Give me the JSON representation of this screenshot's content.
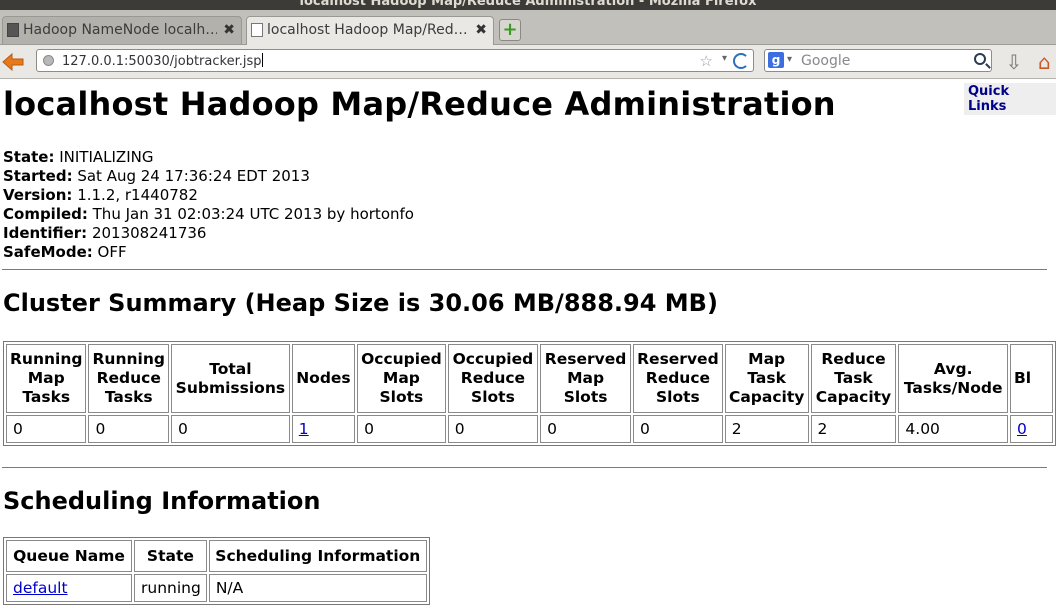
{
  "window": {
    "title": "localhost Hadoop Map/Reduce Administration - Mozilla Firefox"
  },
  "tabs": [
    {
      "label": "Hadoop NameNode localh…",
      "close": "✖"
    },
    {
      "label": "localhost Hadoop Map/Red…",
      "close": "✖"
    }
  ],
  "navbar": {
    "url": "127.0.0.1:50030/jobtracker.jsp",
    "search_placeholder": "Google",
    "search_engine_letter": "g",
    "star": "☆",
    "dropdown": "▾"
  },
  "page": {
    "quick_links": "Quick Links",
    "title": "localhost Hadoop Map/Reduce Administration",
    "info": [
      {
        "label": "State:",
        "value": " INITIALIZING"
      },
      {
        "label": "Started:",
        "value": " Sat Aug 24 17:36:24 EDT 2013"
      },
      {
        "label": "Version:",
        "value": " 1.1.2, r1440782"
      },
      {
        "label": "Compiled:",
        "value": " Thu Jan 31 02:03:24 UTC 2013 by hortonfo"
      },
      {
        "label": "Identifier:",
        "value": " 201308241736"
      },
      {
        "label": "SafeMode:",
        "value": " OFF"
      }
    ],
    "cluster_summary_title": "Cluster Summary (Heap Size is 30.06 MB/888.94 MB)",
    "cluster_summary": {
      "headers": [
        "Running Map Tasks",
        "Running Reduce Tasks",
        "Total Submissions",
        "Nodes",
        "Occupied Map Slots",
        "Occupied Reduce Slots",
        "Reserved Map Slots",
        "Reserved Reduce Slots",
        "Map Task Capacity",
        "Reduce Task Capacity",
        "Avg. Tasks/Node",
        "Bl"
      ],
      "row": [
        "0",
        "0",
        "0",
        "1",
        "0",
        "0",
        "0",
        "0",
        "2",
        "2",
        "4.00",
        "0"
      ]
    },
    "scheduling_title": "Scheduling Information",
    "scheduling": {
      "headers": [
        "Queue Name",
        "State",
        "Scheduling Information"
      ],
      "rows": [
        [
          "default",
          "running",
          "N/A"
        ]
      ]
    }
  }
}
